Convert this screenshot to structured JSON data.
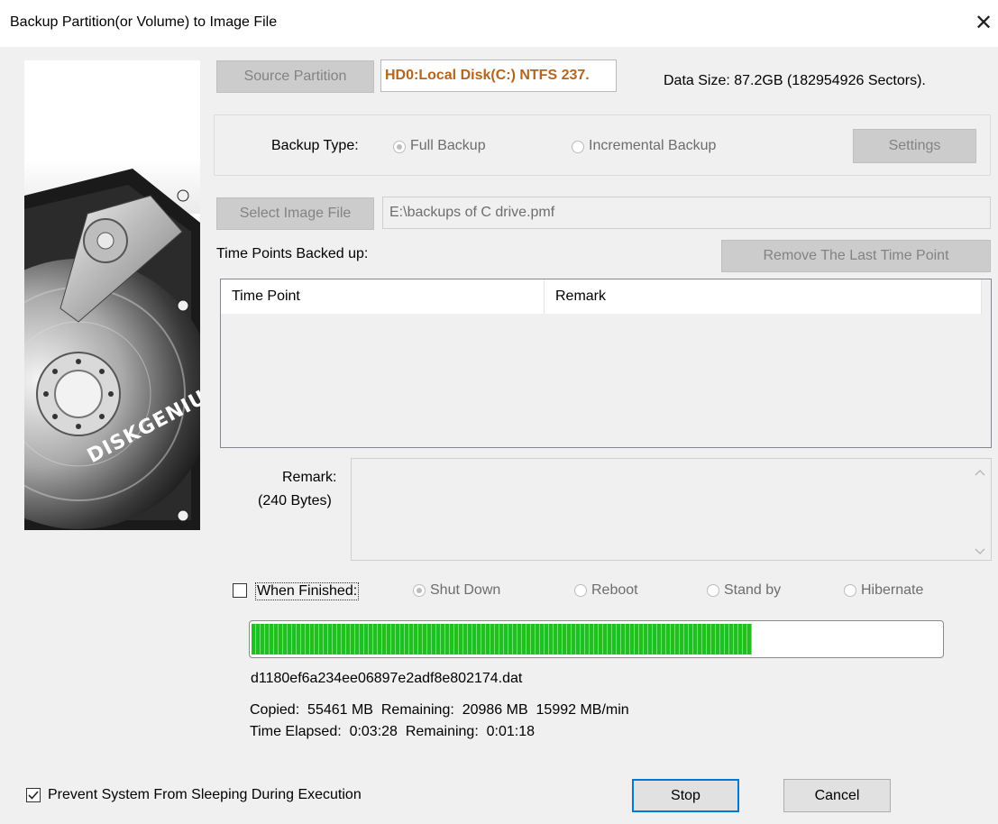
{
  "window": {
    "title": "Backup Partition(or Volume) to Image File",
    "close_glyph": "✕"
  },
  "source": {
    "button_label": "Source Partition",
    "value": "HD0:Local Disk(C:) NTFS 237.",
    "data_size": "Data Size: 87.2GB (182954926 Sectors)."
  },
  "backup_type": {
    "label": "Backup Type:",
    "full_label": "Full Backup",
    "incremental_label": "Incremental Backup",
    "selected": "Full Backup",
    "settings_label": "Settings"
  },
  "image_file": {
    "button_label": "Select Image File",
    "value": "E:\\backups of C drive.pmf"
  },
  "time_points": {
    "label": "Time Points Backed up:",
    "remove_label": "Remove The Last Time Point",
    "columns": [
      "Time Point",
      "Remark"
    ],
    "rows": []
  },
  "remark": {
    "label": "Remark:",
    "size": "(240 Bytes)"
  },
  "when_finished": {
    "label": "When Finished:",
    "checked": false,
    "options": [
      "Shut Down",
      "Reboot",
      "Stand by",
      "Hibernate"
    ],
    "selected": "Shut Down"
  },
  "progress": {
    "fraction": 0.725,
    "file": "d1180ef6a234ee06897e2adf8e802174.dat",
    "line1": "Copied:  55461 MB  Remaining:  20986 MB  15992 MB/min",
    "line2": "Time Elapsed:  0:03:28  Remaining:  0:01:18"
  },
  "prevent_sleep": {
    "label": "Prevent System From Sleeping During Execution",
    "checked": true
  },
  "actions": {
    "stop_label": "Stop",
    "cancel_label": "Cancel"
  },
  "brand": {
    "logo_text": "DISKGENIUS"
  },
  "colors": {
    "source_value": "#b5651d",
    "progress": "#20c020",
    "focus_border": "#0078d7"
  }
}
